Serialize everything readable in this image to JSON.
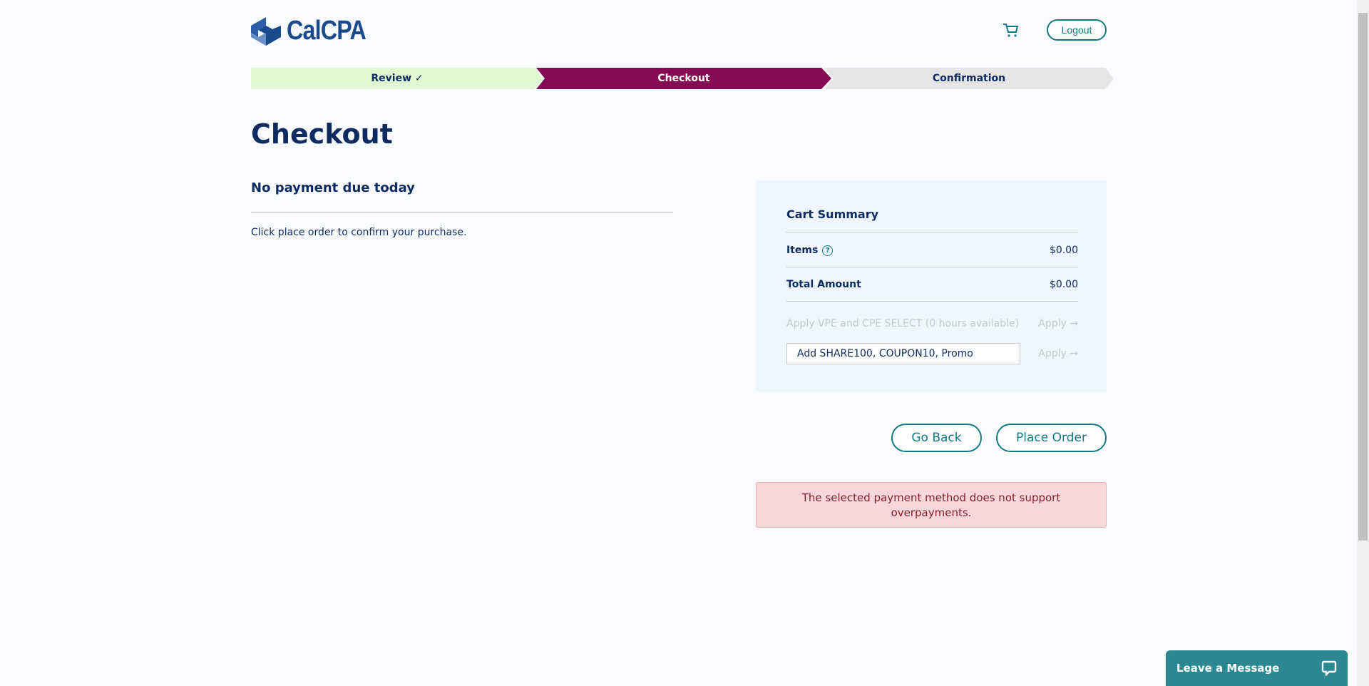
{
  "header": {
    "logo_text": "CalCPA",
    "logout_label": "Logout"
  },
  "steps": [
    {
      "label": "Review ✓"
    },
    {
      "label": "Checkout"
    },
    {
      "label": "Confirmation"
    }
  ],
  "page_title": "Checkout",
  "payment": {
    "heading": "No payment due today",
    "message": "Click place order to confirm your purchase."
  },
  "cart_summary": {
    "title": "Cart Summary",
    "items_label": "Items",
    "items_value": "$0.00",
    "total_label": "Total Amount",
    "total_value": "$0.00",
    "vpe_label": "Apply VPE and CPE SELECT (0 hours available)",
    "apply_label": "Apply →",
    "coupon_placeholder": "Add SHARE100, COUPON10, Promo"
  },
  "buttons": {
    "go_back": "Go Back",
    "place_order": "Place Order"
  },
  "error": "The selected payment method does not support overpayments.",
  "chat": {
    "label": "Leave a Message"
  }
}
